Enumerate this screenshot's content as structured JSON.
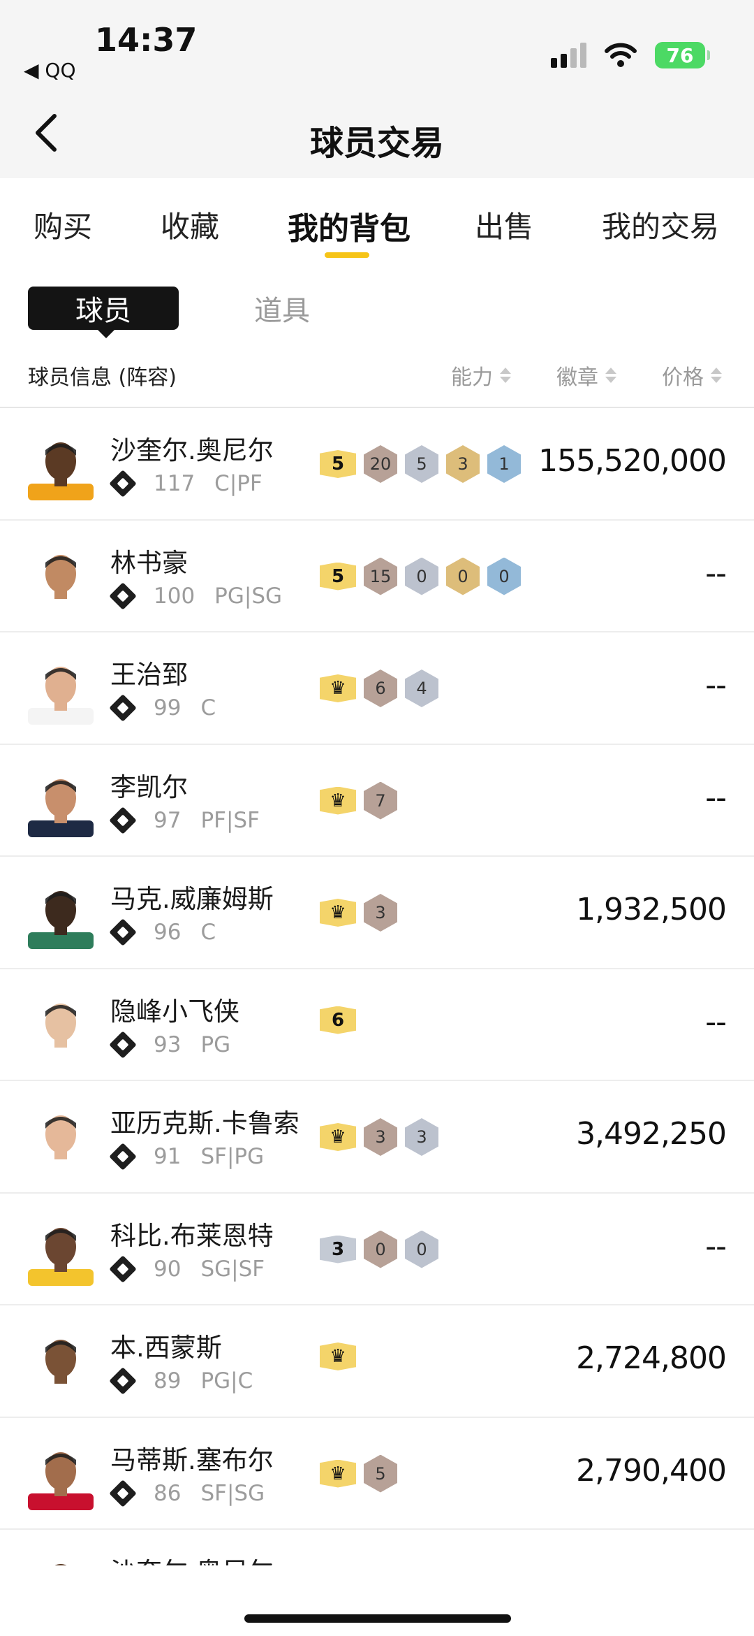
{
  "status_bar": {
    "time": "14:37",
    "back_app": "◀ QQ",
    "battery": "76"
  },
  "header": {
    "title": "球员交易"
  },
  "tabs": [
    {
      "label": "购买"
    },
    {
      "label": "收藏"
    },
    {
      "label": "我的背包"
    },
    {
      "label": "出售"
    },
    {
      "label": "我的交易"
    }
  ],
  "subtabs": {
    "active": "球员",
    "inactive": "道具"
  },
  "columns": {
    "info": "球员信息 (阵容)",
    "ability": "能力",
    "badge": "徽章",
    "price": "价格"
  },
  "players": [
    {
      "name": "沙奎尔.奥尼尔",
      "ovr": "117",
      "pos": "C|PF",
      "tier": "5",
      "tier_type": "gold",
      "badges": [
        {
          "v": "20",
          "t": "hof"
        },
        {
          "v": "5",
          "t": "silver"
        },
        {
          "v": "3",
          "t": "gold"
        },
        {
          "v": "1",
          "t": "bronze"
        }
      ],
      "price": "155,520,000",
      "jersey": "#f0a31a",
      "skin": "#5b3a24"
    },
    {
      "name": "林书豪",
      "ovr": "100",
      "pos": "PG|SG",
      "tier": "5",
      "tier_type": "gold",
      "badges": [
        {
          "v": "15",
          "t": "hof"
        },
        {
          "v": "0",
          "t": "silver"
        },
        {
          "v": "0",
          "t": "gold"
        },
        {
          "v": "0",
          "t": "bronze"
        }
      ],
      "price": "--",
      "jersey": "#ffffff",
      "skin": "#c18a63"
    },
    {
      "name": "王治郅",
      "ovr": "99",
      "pos": "C",
      "tier": "♛",
      "tier_type": "gold",
      "badges": [
        {
          "v": "6",
          "t": "hof"
        },
        {
          "v": "4",
          "t": "silver"
        }
      ],
      "price": "--",
      "jersey": "#f4f4f4",
      "skin": "#e0b090"
    },
    {
      "name": "李凯尔",
      "ovr": "97",
      "pos": "PF|SF",
      "tier": "♛",
      "tier_type": "gold",
      "badges": [
        {
          "v": "7",
          "t": "hof"
        }
      ],
      "price": "--",
      "jersey": "#1e2a44",
      "skin": "#c88f6c"
    },
    {
      "name": "马克.威廉姆斯",
      "ovr": "96",
      "pos": "C",
      "tier": "♛",
      "tier_type": "gold",
      "badges": [
        {
          "v": "3",
          "t": "hof"
        }
      ],
      "price": "1,932,500",
      "jersey": "#2e7d5b",
      "skin": "#3d2a1e"
    },
    {
      "name": "隐峰小飞侠",
      "ovr": "93",
      "pos": "PG",
      "tier": "6",
      "tier_type": "gold",
      "badges": [],
      "price": "--",
      "jersey": "#ffffff",
      "skin": "#e6c1a2"
    },
    {
      "name": "亚历克斯.卡鲁索",
      "ovr": "91",
      "pos": "SF|PG",
      "tier": "♛",
      "tier_type": "gold",
      "badges": [
        {
          "v": "3",
          "t": "hof"
        },
        {
          "v": "3",
          "t": "silver"
        }
      ],
      "price": "3,492,250",
      "jersey": "#ffffff",
      "skin": "#e5b899"
    },
    {
      "name": "科比.布莱恩特",
      "ovr": "90",
      "pos": "SG|SF",
      "tier": "3",
      "tier_type": "silver",
      "badges": [
        {
          "v": "0",
          "t": "hof"
        },
        {
          "v": "0",
          "t": "silver"
        }
      ],
      "price": "--",
      "jersey": "#f3c42d",
      "skin": "#6b4631"
    },
    {
      "name": "本.西蒙斯",
      "ovr": "89",
      "pos": "PG|C",
      "tier": "♛",
      "tier_type": "gold",
      "badges": [],
      "price": "2,724,800",
      "jersey": "#ffffff",
      "skin": "#7a5236"
    },
    {
      "name": "马蒂斯.塞布尔",
      "ovr": "86",
      "pos": "SF|SG",
      "tier": "♛",
      "tier_type": "gold",
      "badges": [
        {
          "v": "5",
          "t": "hof"
        }
      ],
      "price": "2,790,400",
      "jersey": "#c8102e",
      "skin": "#a26d4c"
    },
    {
      "name": "沙奎尔.奥尼尔",
      "ovr": "",
      "pos": "",
      "tier": "",
      "tier_type": "gold",
      "badges": [],
      "price": "",
      "jersey": "#f0a31a",
      "skin": "#5b3a24"
    }
  ]
}
